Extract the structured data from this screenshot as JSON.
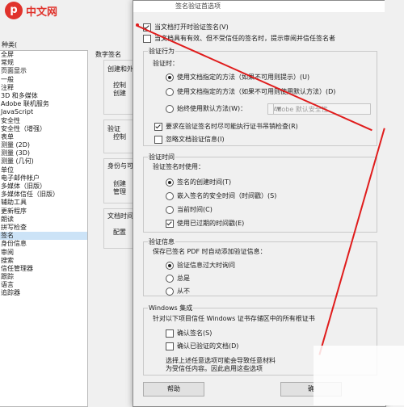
{
  "watermark": {
    "logo_letter": "p",
    "text": "中文网"
  },
  "bg": {
    "category_label": "种类(",
    "categories": [
      "全屏",
      "常规",
      "页面显示",
      "一般",
      "注释",
      "3D 和多媒体",
      "Adobe 联机服务",
      "JavaScript",
      "安全性",
      "安全性（增强）",
      "表单",
      "测量 (2D)",
      "测量 (3D)",
      "测量 (几何)",
      "单位",
      "电子邮件帐户",
      "多媒体（旧版）",
      "多媒体信任（旧版）",
      "辅助工具",
      "更新程序",
      "朗读",
      "拼写检查",
      "签名",
      "身份信息",
      "审阅",
      "搜索",
      "信任管理器",
      "跟踪",
      "语言",
      "追踪器"
    ],
    "selected_index": 22,
    "signature_heading": "数字签名",
    "group1_label": "创建和外",
    "group1_items": [
      "控制",
      "创建"
    ],
    "group2_label": "验证",
    "group2_item": "控制",
    "group3_label": "身份与可",
    "group3_items": [
      "创建",
      "管理"
    ],
    "group4_label": "文档时间",
    "group4_item": "配置"
  },
  "dialog": {
    "title": "签名验证首选项",
    "verify_on_open": "当文档打开时验证签名(V)",
    "hide_invalid": "当文档具有有效、但不受信任的签名时，提示审阅并信任签名者",
    "behavior": {
      "title": "验证行为",
      "subtitle": "验证时：",
      "opt1": "使用文档指定的方法（如果不可用则提示）(U)",
      "opt2": "使用文档指定的方法（如果不可用则使用默认方法）(D)",
      "opt3": "始终使用默认方法(W)：",
      "select_value": "Adobe 默认安全性",
      "require_revocation": "要求在验证签名时尽可能执行证书吊销检查(R)",
      "ignore_timestamp": "忽略文档验证信息(I)"
    },
    "time": {
      "title": "验证时间",
      "subtitle": "验证签名时使用：",
      "opt1": "签名的创建时间(T)",
      "opt2": "嵌入签名的安全时间（时间戳）(S)",
      "opt3": "当前时间(C)",
      "expired_timestamp": "使用已过期的时间戳(E)"
    },
    "info": {
      "title": "验证信息",
      "subtitle": "保存已签名 PDF 时自动添加验证信息：",
      "opt1": "验证信息过大时询问",
      "opt2": "总是",
      "opt3": "从不"
    },
    "windows": {
      "title": "Windows 集成",
      "subtitle": "针对以下项目信任 Windows 证书存储区中的所有根证书",
      "cb1": "确认签名(S)",
      "cb2": "确认已验证的文档(D)",
      "note1": "选择上述任意选项可能会导致任意材料",
      "note2": "为受信任内容。因此启用这些选项"
    },
    "help_button": "帮助",
    "ok_button": "确"
  }
}
